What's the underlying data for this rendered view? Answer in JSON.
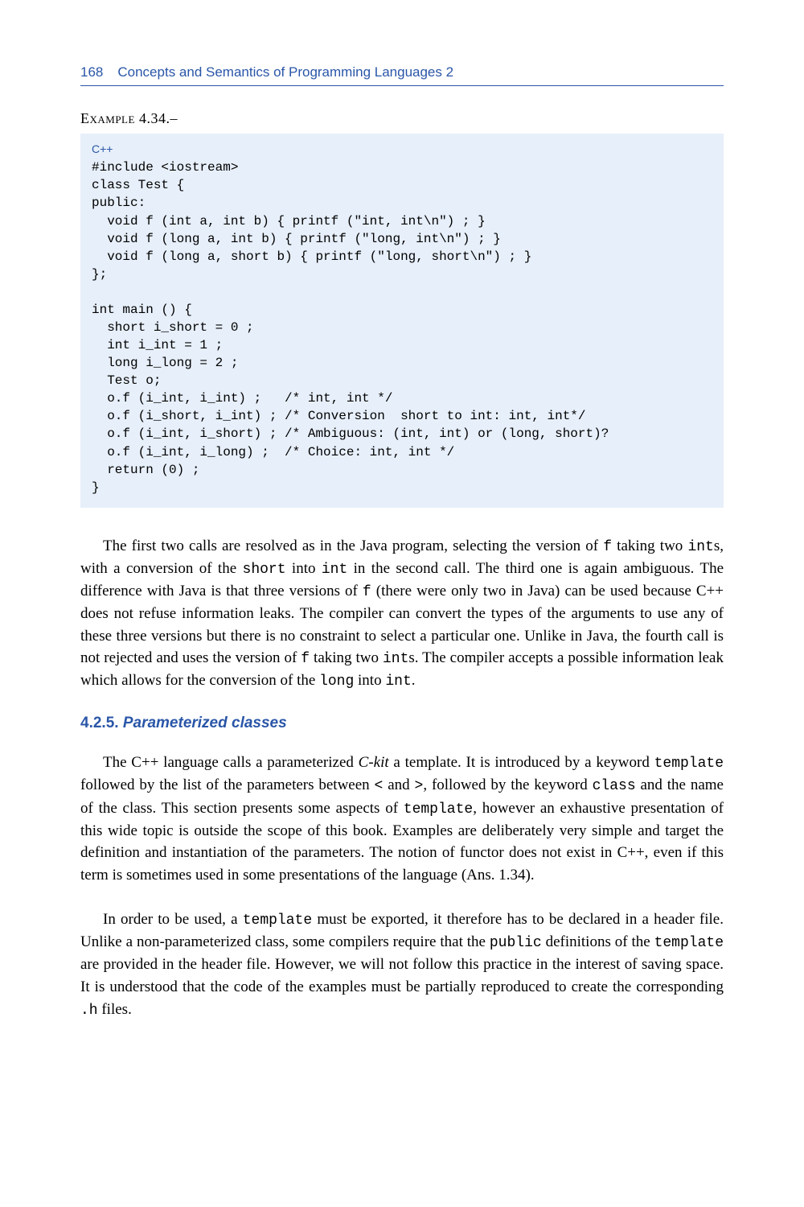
{
  "header": {
    "page_number": "168",
    "running_title": "Concepts and Semantics of Programming Languages 2"
  },
  "example": {
    "label_prefix": "Example",
    "label_number": " 4.34.–",
    "language": "C++",
    "code": "#include <iostream>\nclass Test {\npublic:\n  void f (int a, int b) { printf (\"int, int\\n\") ; }\n  void f (long a, int b) { printf (\"long, int\\n\") ; }\n  void f (long a, short b) { printf (\"long, short\\n\") ; }\n};\n\nint main () {\n  short i_short = 0 ;\n  int i_int = 1 ;\n  long i_long = 2 ;\n  Test o;\n  o.f (i_int, i_int) ;   /* int, int */\n  o.f (i_short, i_int) ; /* Conversion  short to int: int, int*/\n  o.f (i_int, i_short) ; /* Ambiguous: (int, int) or (long, short)?\n  o.f (i_int, i_long) ;  /* Choice: int, int */\n  return (0) ;\n}"
  },
  "para1": {
    "t1": "The first two calls are resolved as in the Java program, selecting the version of ",
    "c1": "f",
    "t2": " taking two ",
    "c2": "int",
    "t3": "s, with a conversion of the ",
    "c3": "short",
    "t4": " into ",
    "c4": "int",
    "t5": " in the second call. The third one is again ambiguous. The difference with Java is that three versions of ",
    "c5": "f",
    "t6": " (there were only two in Java) can be used because C++ does not refuse information leaks. The compiler can convert the types of the arguments to use any of these three versions but there is no constraint to select a particular one. Unlike in Java, the fourth call is not rejected and uses the version of ",
    "c6": "f",
    "t7": " taking two ",
    "c7": "int",
    "t8": "s. The compiler accepts a possible information leak which allows for the conversion of the ",
    "c8": "long",
    "t9": " into ",
    "c9": "int",
    "t10": "."
  },
  "section": {
    "number": "4.2.5.",
    "title": "Parameterized classes"
  },
  "para2": {
    "t1": "The C++ language calls a parameterized ",
    "i1": "C-kit",
    "t2": " a template. It is introduced by a keyword ",
    "c1": "template",
    "t3": " followed by the list of the parameters between ",
    "c2": "<",
    "t4": " and ",
    "c3": ">",
    "t5": ", followed by the keyword ",
    "c4": "class",
    "t6": " and the name of the class. This section presents some aspects of ",
    "c5": "template",
    "t7": ", however an exhaustive presentation of this wide topic is outside the scope of this book. Examples are deliberately very simple and target the definition and instantiation of the parameters. The notion of functor does not exist in C++, even if this term is sometimes used in some presentations of the language (Ans. 1.34)."
  },
  "para3": {
    "t1": "In order to be used, a ",
    "c1": "template",
    "t2": " must be exported, it therefore has to be declared in a header file. Unlike a non-parameterized class, some compilers require that the ",
    "c2": "public",
    "t3": " definitions of the ",
    "c3": "template",
    "t4": " are provided in the header file. However, we will not follow this practice in the interest of saving space. It is understood that the code of the examples must be partially reproduced to create the corresponding ",
    "c4": ".h",
    "t5": " files."
  }
}
